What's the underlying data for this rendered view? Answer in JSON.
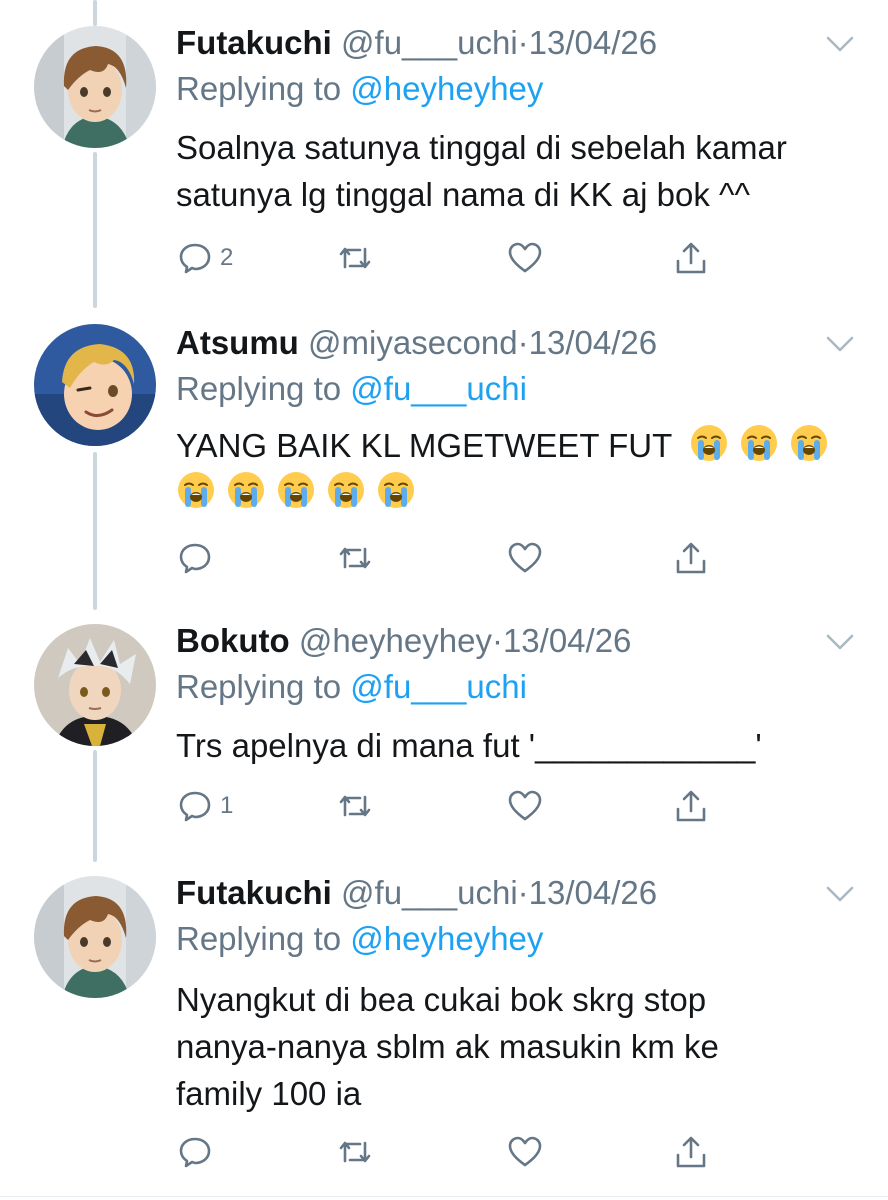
{
  "tweets": [
    {
      "name": "Futakuchi",
      "handle": "@fu___uchi",
      "dot": "·",
      "date": "13/04/26",
      "replying_label": "Replying to",
      "replying_to": "@heyheyhey",
      "text_lines": [
        "Soalnya satunya tinggal di sebelah kamar",
        "satunya lg tinggal nama di KK aj bok ^^"
      ],
      "reply_count": "2",
      "avatar": "futakuchi-avatar"
    },
    {
      "name": "Atsumu",
      "handle": "@miyasecond",
      "dot": "·",
      "date": "13/04/26",
      "replying_label": "Replying to",
      "replying_to": "@fu___uchi",
      "text_lines": [
        "YANG BAIK KL MGETWEET FUT"
      ],
      "emoji": "loudly-crying-face",
      "emoji_count_line1": 3,
      "emoji_count_line2": 5,
      "reply_count": "",
      "avatar": "atsumu-avatar"
    },
    {
      "name": "Bokuto",
      "handle": "@heyheyhey",
      "dot": "·",
      "date": "13/04/26",
      "replying_label": "Replying to",
      "replying_to": "@fu___uchi",
      "text_lines": [
        "Trs apelnya di mana fut '____________'"
      ],
      "reply_count": "1",
      "avatar": "bokuto-avatar"
    },
    {
      "name": "Futakuchi",
      "handle": "@fu___uchi",
      "dot": "·",
      "date": "13/04/26",
      "replying_label": "Replying to",
      "replying_to": "@heyheyhey",
      "text_lines": [
        "Nyangkut di bea cukai bok skrg stop",
        "nanya-nanya sblm ak masukin km ke",
        "family 100 ia"
      ],
      "reply_count": "",
      "avatar": "futakuchi-avatar"
    }
  ],
  "colors": {
    "text": "#14171a",
    "secondary": "#657786",
    "link": "#1da1f2",
    "thread_line": "#ccd6dd"
  }
}
